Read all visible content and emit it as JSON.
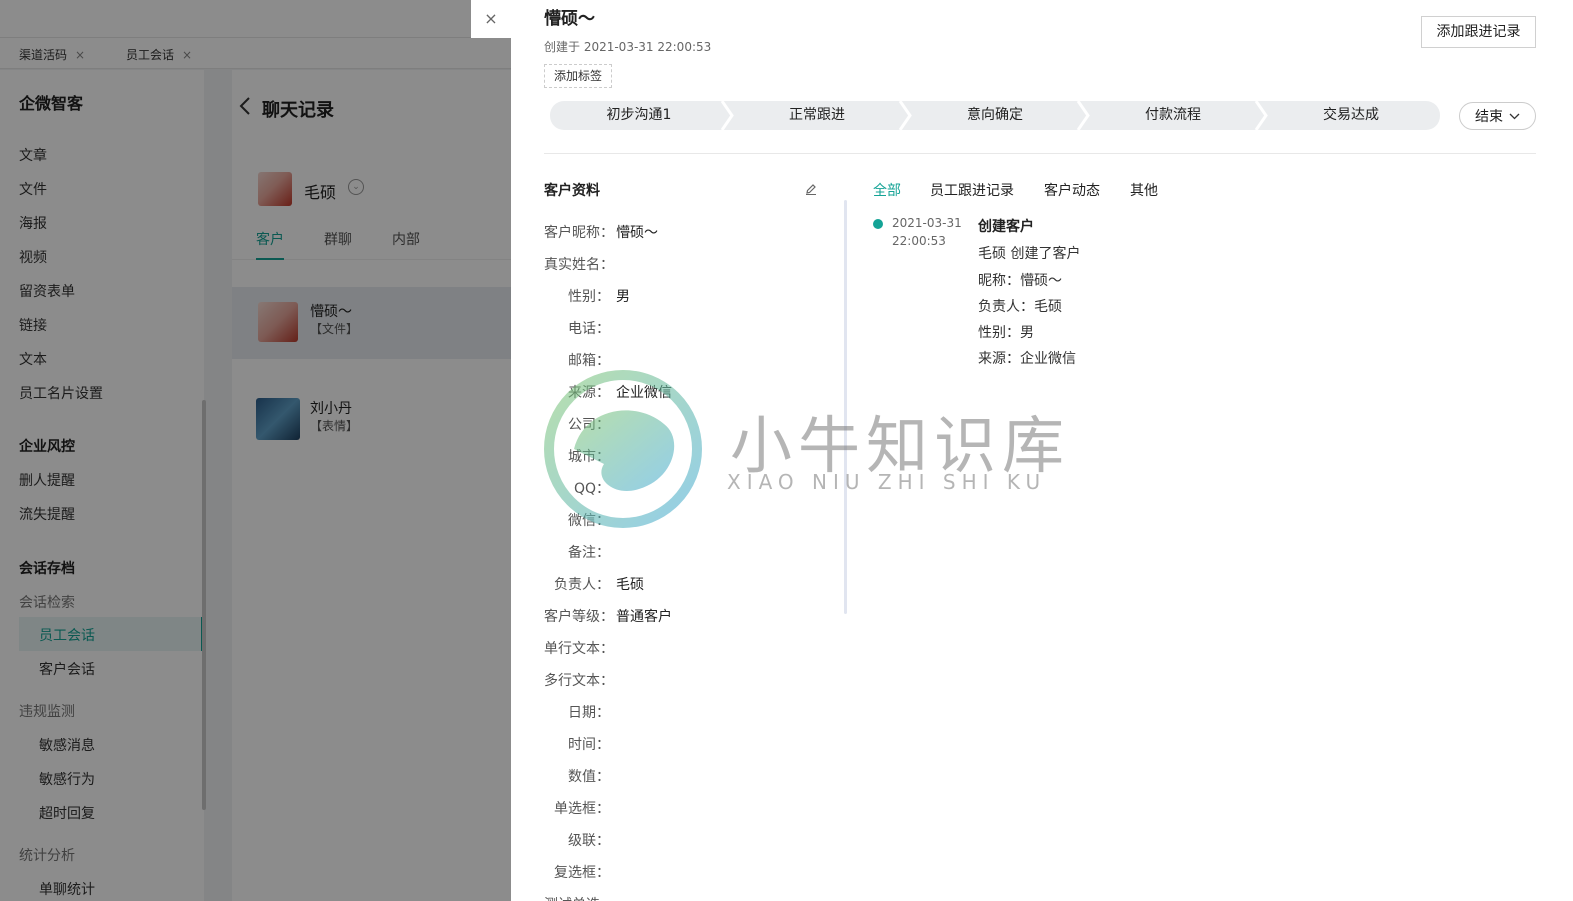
{
  "page_tabs": [
    {
      "label": "渠道活码",
      "close": "×"
    },
    {
      "label": "员工会话",
      "close": "×"
    }
  ],
  "sidebar": {
    "brand": "企微智客",
    "items": [
      "文章",
      "文件",
      "海报",
      "视频",
      "留资表单",
      "链接",
      "文本",
      "员工名片设置"
    ],
    "group_risk": "企业风控",
    "risk_items": [
      "删人提醒",
      "流失提醒"
    ],
    "group_archive": "会话存档",
    "archive_sub": "会话检索",
    "archive_items": [
      "员工会话",
      "客户会话"
    ],
    "monitor_sub": "违规监测",
    "monitor_items": [
      "敏感消息",
      "敏感行为",
      "超时回复"
    ],
    "stats_sub": "统计分析",
    "stats_items": [
      "单聊统计"
    ]
  },
  "chat": {
    "title": "聊天记录",
    "person": "毛硕",
    "tabs": [
      "客户",
      "群聊",
      "内部"
    ],
    "conversations": [
      {
        "name": "懵硕～",
        "sub": "【文件】"
      },
      {
        "name": "刘小丹",
        "sub": "【表情】"
      }
    ]
  },
  "drawer": {
    "close": "×",
    "title": "懵硕～",
    "created": "创建于 2021-03-31 22:00:53",
    "tag_button": "添加标签",
    "add_record_button": "添加跟进记录",
    "stages": [
      "初步沟通1",
      "正常跟进",
      "意向确定",
      "付款流程",
      "交易达成"
    ],
    "end_button": "结束",
    "info_title": "客户资料",
    "fields": [
      {
        "label": "客户昵称：",
        "value": "懵硕～"
      },
      {
        "label": "真实姓名：",
        "value": ""
      },
      {
        "label": "性别：",
        "value": "男"
      },
      {
        "label": "电话：",
        "value": ""
      },
      {
        "label": "邮箱：",
        "value": ""
      },
      {
        "label": "来源：",
        "value": "企业微信"
      },
      {
        "label": "公司：",
        "value": ""
      },
      {
        "label": "城市：",
        "value": ""
      },
      {
        "label": "QQ：",
        "value": ""
      },
      {
        "label": "微信：",
        "value": ""
      },
      {
        "label": "备注：",
        "value": ""
      },
      {
        "label": "负责人：",
        "value": "毛硕"
      },
      {
        "label": "客户等级：",
        "value": "普通客户"
      },
      {
        "label": "单行文本：",
        "value": ""
      },
      {
        "label": "多行文本：",
        "value": ""
      },
      {
        "label": "日期：",
        "value": ""
      },
      {
        "label": "时间：",
        "value": ""
      },
      {
        "label": "数值：",
        "value": ""
      },
      {
        "label": "单选框：",
        "value": ""
      },
      {
        "label": "级联：",
        "value": ""
      },
      {
        "label": "复选框：",
        "value": ""
      },
      {
        "label": "测试单选",
        "value": ""
      }
    ],
    "timeline_tabs": [
      "全部",
      "员工跟进记录",
      "客户动态",
      "其他"
    ],
    "timeline": {
      "date": "2021-03-31",
      "time": "22:00:53",
      "title": "创建客户",
      "lines": [
        "毛硕 创建了客户",
        "昵称：懵硕～",
        "负责人：毛硕",
        "性别：男",
        "来源：企业微信"
      ]
    }
  },
  "watermark": {
    "cn": "小牛知识库",
    "en": "XIAO NIU ZHI SHI KU"
  },
  "colors": {
    "accent": "#14a396",
    "overlay": "rgba(0,0,0,0.45)"
  }
}
